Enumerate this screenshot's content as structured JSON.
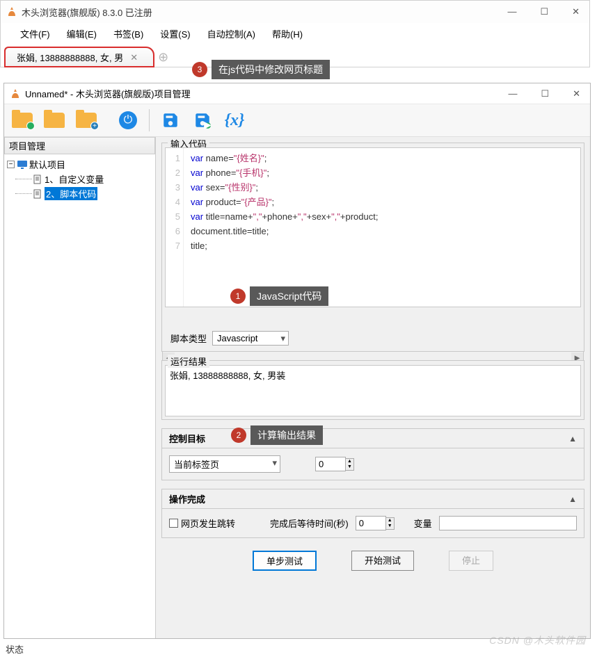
{
  "main": {
    "title": "木头浏览器(旗舰版) 8.3.0  已注册",
    "menus": [
      "文件(F)",
      "编辑(E)",
      "书签(B)",
      "设置(S)",
      "自动控制(A)",
      "帮助(H)"
    ],
    "tab_title": "张娟, 13888888888, 女, 男"
  },
  "annotations": {
    "a1": "JavaScript代码",
    "a2": "计算输出结果",
    "a3": "在js代码中修改网页标题"
  },
  "child": {
    "title": "Unnamed* - 木头浏览器(旗舰版)项目管理",
    "panel_header": "项目管理",
    "tree": {
      "root": "默认项目",
      "item1": "1、自定义变量",
      "item2": "2、脚本代码"
    },
    "code_legend": "输入代码",
    "code_lines": [
      {
        "n": "1",
        "pre": "var ",
        "mid": "name=",
        "str": "\"{姓名}\"",
        "post": ";"
      },
      {
        "n": "2",
        "pre": "var ",
        "mid": "phone=",
        "str": "\"{手机}\"",
        "post": ";"
      },
      {
        "n": "3",
        "pre": "var ",
        "mid": "sex=",
        "str": "\"{性别}\"",
        "post": ";"
      },
      {
        "n": "4",
        "pre": "var ",
        "mid": "product=",
        "str": "\"{产品}\"",
        "post": ";"
      },
      {
        "n": "5",
        "pre": "var ",
        "mid": "title=name+",
        "str": "\",\"",
        "mid2": "+phone+",
        "str2": "\",\"",
        "mid3": "+sex+",
        "str3": "\",\"",
        "mid4": "+product;",
        "post": ""
      },
      {
        "n": "6",
        "pre": "",
        "mid": "document.title=title;",
        "str": "",
        "post": ""
      },
      {
        "n": "7",
        "pre": "",
        "mid": "title;",
        "str": "",
        "post": ""
      }
    ],
    "script_type_label": "脚本类型",
    "script_type_value": "Javascript",
    "result_legend": "运行结果",
    "result_text": "张娟, 13888888888, 女, 男装",
    "target_head": "控制目标",
    "target_value": "当前标签页",
    "target_spin": "0",
    "done_head": "操作完成",
    "redirect_label": "网页发生跳转",
    "wait_label": "完成后等待时间(秒)",
    "wait_value": "0",
    "var_label": "变量",
    "btn_step": "单步测试",
    "btn_start": "开始测试",
    "btn_stop": "停止",
    "status": "状态"
  },
  "watermark": "CSDN @木头软件园"
}
